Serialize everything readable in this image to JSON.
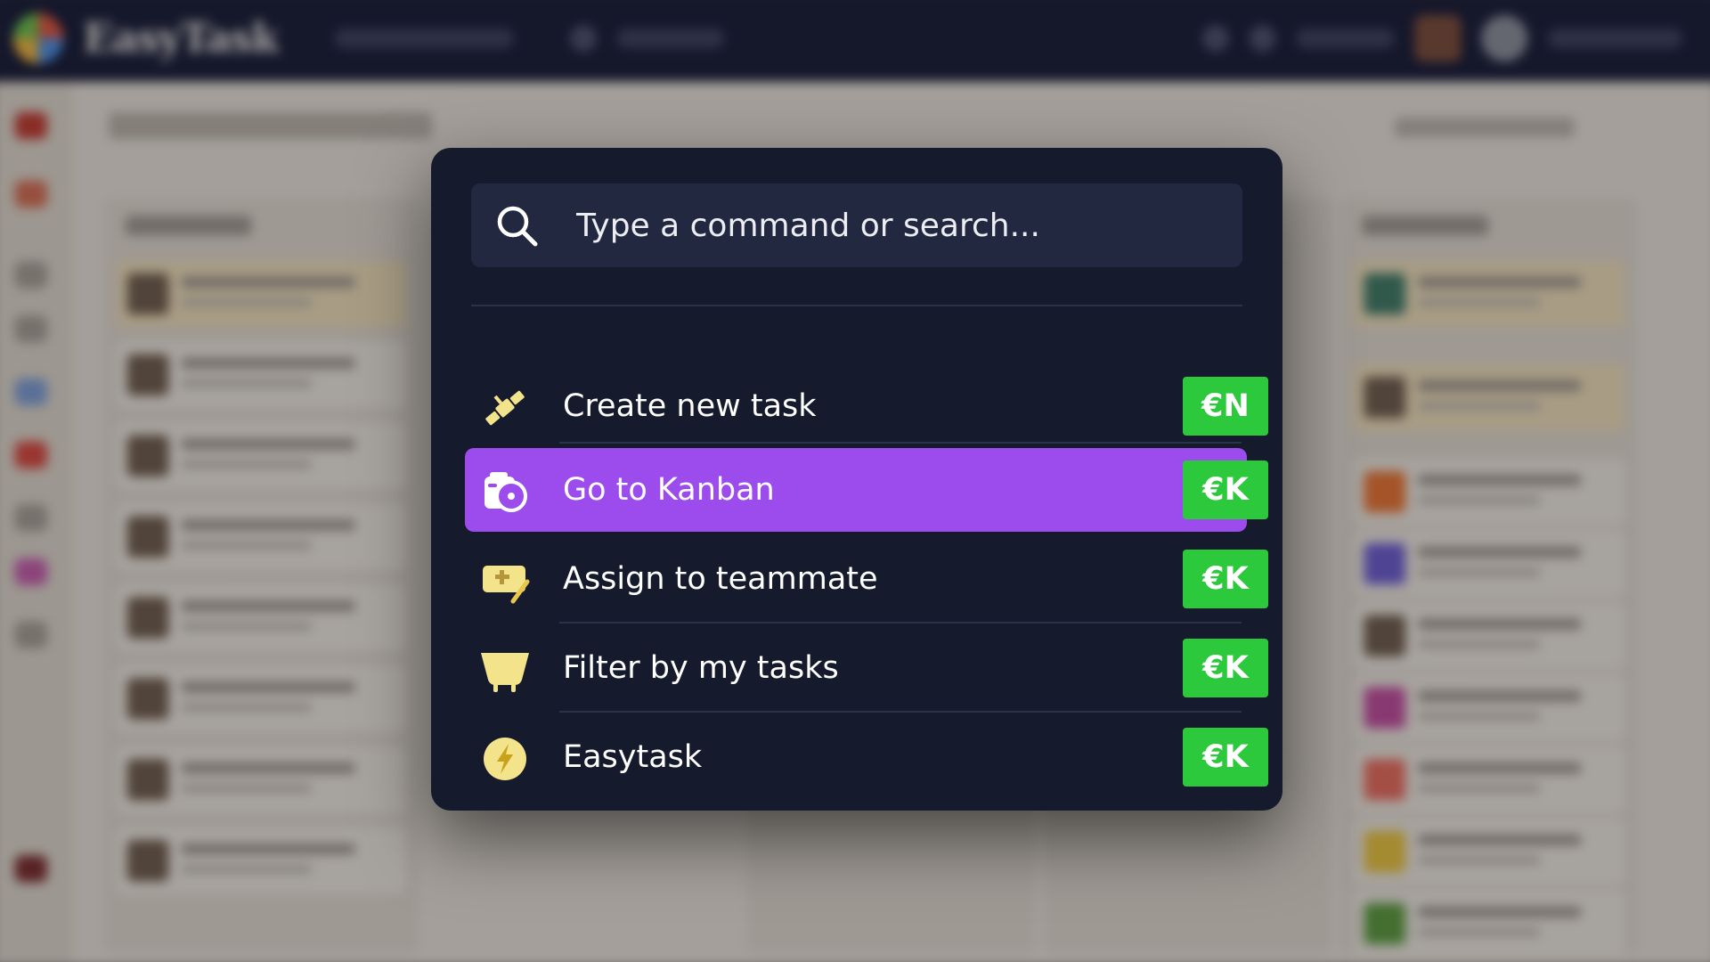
{
  "app": {
    "brand": "EasyTask"
  },
  "palette": {
    "search": {
      "placeholder": "Type a command or search..."
    },
    "items": [
      {
        "label": "Create new task",
        "shortcut": "€N",
        "icon": "satellite-icon",
        "active": false
      },
      {
        "label": "Go to Kanban",
        "shortcut": "€K",
        "icon": "camera-icon",
        "active": true
      },
      {
        "label": "Assign to teammate",
        "shortcut": "€K",
        "icon": "assign-icon",
        "active": false
      },
      {
        "label": "Filter by my tasks",
        "shortcut": "€K",
        "icon": "filter-icon",
        "active": false
      },
      {
        "label": "Easytask",
        "shortcut": "€K",
        "icon": "bolt-icon",
        "active": false
      }
    ]
  },
  "colors": {
    "palette_bg": "#161a2d",
    "search_bg": "#222840",
    "active_row": "#9c4ced",
    "shortcut_bg": "#2cc93c",
    "icon_yellow": "#f3e38a",
    "topbar": "#151833"
  }
}
